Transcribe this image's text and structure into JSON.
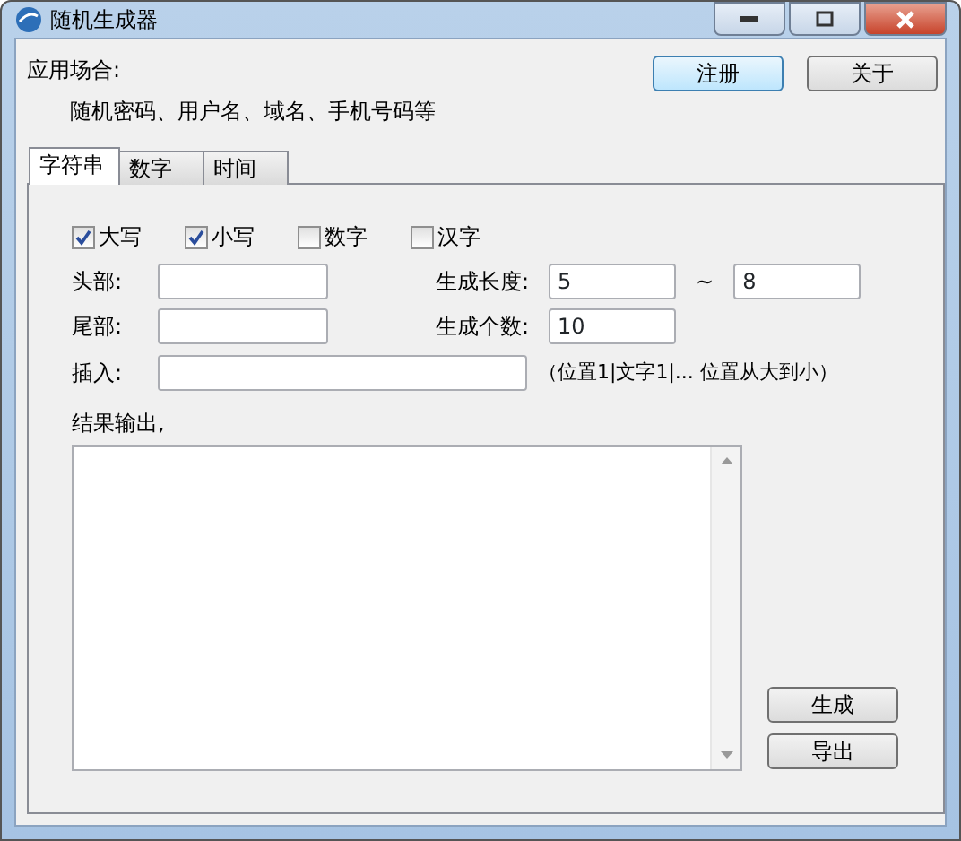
{
  "window": {
    "title": "随机生成器"
  },
  "usage": {
    "label": "应用场合:",
    "description": "随机密码、用户名、域名、手机号码等"
  },
  "top_buttons": [
    "注册",
    "关于"
  ],
  "tabs": [
    {
      "label": "字符串",
      "selected": true
    },
    {
      "label": "数字",
      "selected": false
    },
    {
      "label": "时间",
      "selected": false
    }
  ],
  "options": [
    {
      "label": "大写",
      "checked": true
    },
    {
      "label": "小写",
      "checked": true
    },
    {
      "label": "数字",
      "checked": false
    },
    {
      "label": "汉字",
      "checked": false
    }
  ],
  "fields": {
    "head": {
      "label": "头部:"
    },
    "tail": {
      "label": "尾部:"
    },
    "length": {
      "label": "生成长度:",
      "min": "5",
      "separator": "~",
      "max": "8"
    },
    "count": {
      "label": "生成个数:",
      "value": "10"
    },
    "insert": {
      "label": "插入:",
      "hint": "（位置1|文字1|...  位置从大到小）"
    }
  },
  "output": {
    "label": "结果输出,"
  },
  "action_buttons": [
    "生成",
    "导出"
  ]
}
